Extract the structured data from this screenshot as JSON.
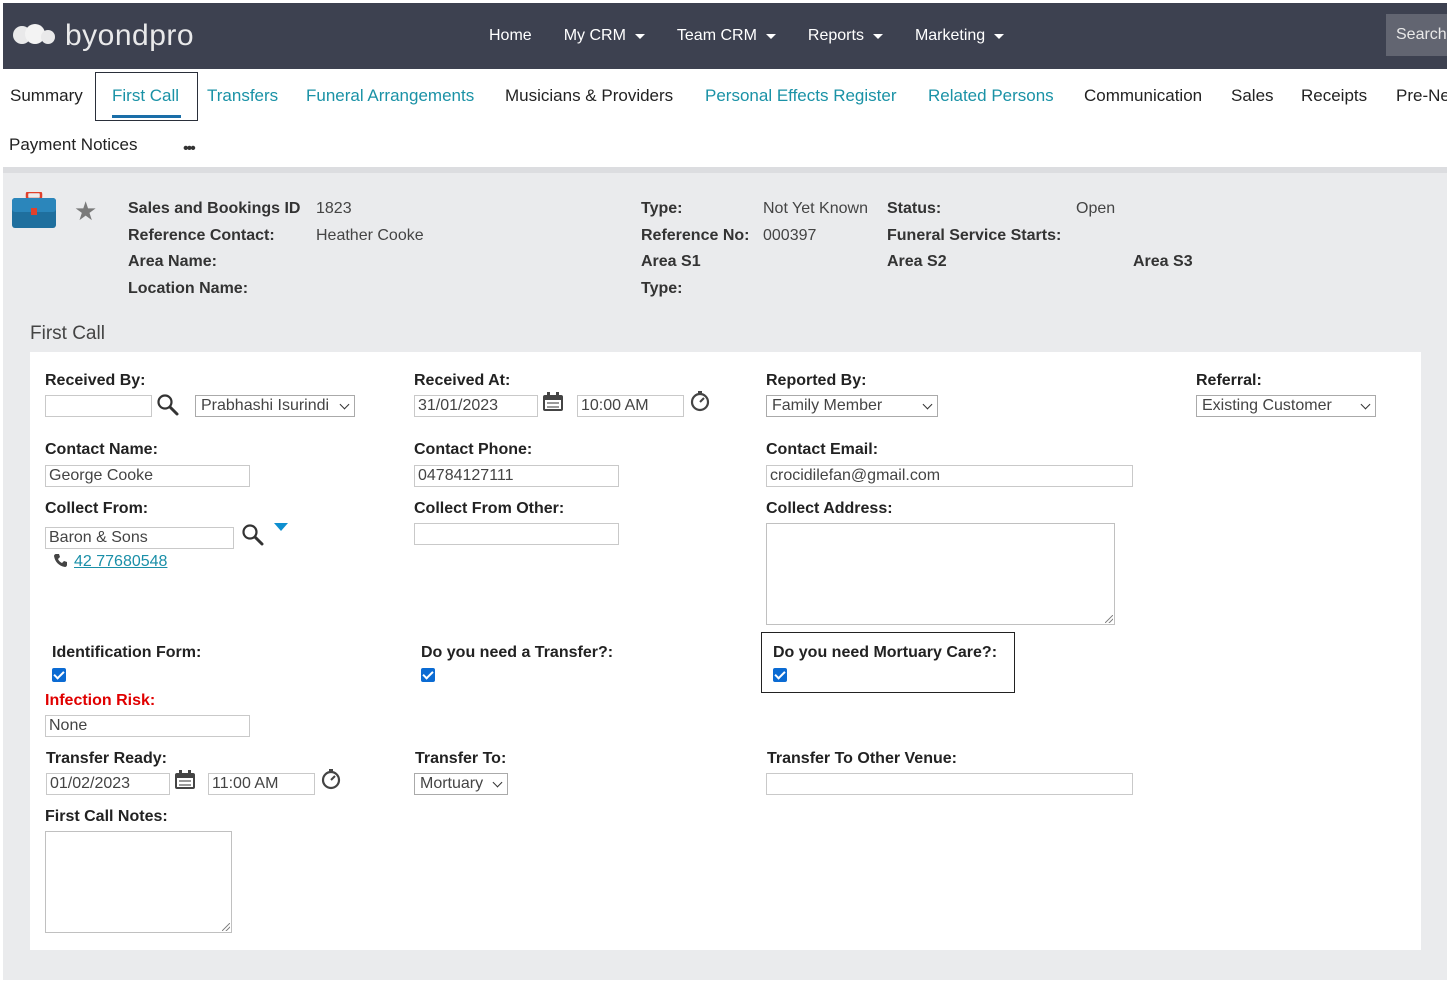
{
  "brand": {
    "name": "byondpro"
  },
  "nav": {
    "items": [
      {
        "label": "Home",
        "caret": false
      },
      {
        "label": "My CRM",
        "caret": true
      },
      {
        "label": "Team CRM",
        "caret": true
      },
      {
        "label": "Reports",
        "caret": true
      },
      {
        "label": "Marketing",
        "caret": true
      }
    ],
    "search_label": "Search"
  },
  "tabs": {
    "row1": [
      "Summary",
      "First Call",
      "Transfers",
      "Funeral Arrangements",
      "Musicians & Providers",
      "Personal Effects Register",
      "Related Persons",
      "Communication",
      "Sales",
      "Receipts",
      "Pre-Ne"
    ],
    "row2": [
      "Payment Notices"
    ],
    "more_label": "•••",
    "active": "First Call"
  },
  "header": {
    "id_label": "Sales and Bookings ID",
    "id_value": "1823",
    "ref_contact_label": "Reference Contact:",
    "ref_contact_value": "Heather Cooke",
    "area_name_label": "Area Name:",
    "location_name_label": "Location Name:",
    "type_label": "Type:",
    "type_value": "Not Yet Known",
    "ref_no_label": "Reference No:",
    "ref_no_value": "000397",
    "area_s1_label": "Area S1",
    "type2_label": "Type:",
    "status_label": "Status:",
    "status_value": "Open",
    "funeral_start_label": "Funeral Service Starts:",
    "area_s2_label": "Area S2",
    "area_s3_label": "Area S3"
  },
  "section_title": "First Call",
  "form": {
    "received_by_label": "Received By:",
    "received_by_input": "",
    "received_by_select": "Prabhashi Isurindi",
    "received_at_label": "Received At:",
    "received_at_date": "31/01/2023",
    "received_at_time": "10:00 AM",
    "reported_by_label": "Reported By:",
    "reported_by_value": "Family Member",
    "referral_label": "Referral:",
    "referral_value": "Existing Customer",
    "contact_name_label": "Contact Name:",
    "contact_name_value": "George Cooke",
    "contact_phone_label": "Contact Phone:",
    "contact_phone_value": "04784127111",
    "contact_email_label": "Contact Email:",
    "contact_email_value": "crocidilefan@gmail.com",
    "collect_from_label": "Collect From:",
    "collect_from_value": "Baron & Sons",
    "collect_from_phone": "42 77680548",
    "collect_from_other_label": "Collect From Other:",
    "collect_from_other_value": "",
    "collect_address_label": "Collect Address:",
    "identification_label": "Identification Form:",
    "identification_checked": true,
    "transfer_q_label": "Do you need a Transfer?:",
    "transfer_q_checked": true,
    "mortuary_q_label": "Do you need Mortuary Care?:",
    "mortuary_q_checked": true,
    "infection_label": "Infection Risk:",
    "infection_value": "None",
    "transfer_ready_label": "Transfer Ready:",
    "transfer_ready_date": "01/02/2023",
    "transfer_ready_time": "11:00 AM",
    "transfer_to_label": "Transfer To:",
    "transfer_to_value": "Mortuary",
    "transfer_other_label": "Transfer To Other Venue:",
    "transfer_other_value": "",
    "notes_label": "First Call Notes:"
  },
  "colors": {
    "nav_bg": "#3d4150",
    "link": "#1a92a6",
    "danger": "#e00000",
    "checkbox": "#0b6bd3",
    "panel_bg": "#eaebed"
  },
  "icons": [
    "briefcase-icon",
    "star-icon",
    "search-icon",
    "calendar-icon",
    "clock-icon",
    "phone-icon",
    "triangle-down-icon"
  ]
}
